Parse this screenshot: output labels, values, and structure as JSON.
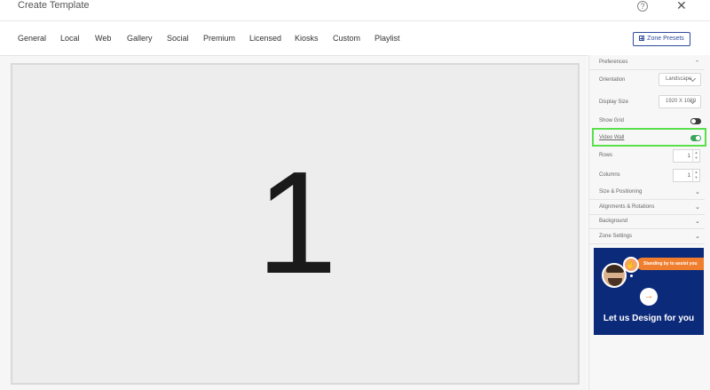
{
  "header": {
    "title": "Create Template",
    "help_icon": "?",
    "close_icon": "✕"
  },
  "tabs": [
    "General",
    "Local",
    "Web",
    "Gallery",
    "Social",
    "Premium",
    "Licensed",
    "Kiosks",
    "Custom",
    "Playlist"
  ],
  "zone_presets_label": "Zone Presets",
  "canvas": {
    "zone_number": "1",
    "background": "#ededed"
  },
  "panel": {
    "preferences_label": "Preferences",
    "orientation": {
      "label": "Orientation",
      "value": "Landscape"
    },
    "display_size": {
      "label": "Display Size",
      "value": "1920 X 1080"
    },
    "show_grid": {
      "label": "Show Grid",
      "on": false
    },
    "video_wall": {
      "label": "Video Wall",
      "on": true
    },
    "rows": {
      "label": "Rows",
      "value": "1"
    },
    "columns": {
      "label": "Columns",
      "value": "1"
    },
    "sections": [
      "Size & Positioning",
      "Alignments & Rotations",
      "Background",
      "Zone Settings"
    ]
  },
  "banner": {
    "bubble_text": "Standing by to assist you",
    "headline": "Let us Design for you",
    "arrow_icon": "→"
  },
  "colors": {
    "accent": "#2e4a9c",
    "toggle_on": "#3aa55c",
    "toggle_off": "#3c3c3c",
    "highlight": "#59e04b",
    "banner_bg": "#0c2a7a",
    "bubble": "#f07e2f"
  }
}
